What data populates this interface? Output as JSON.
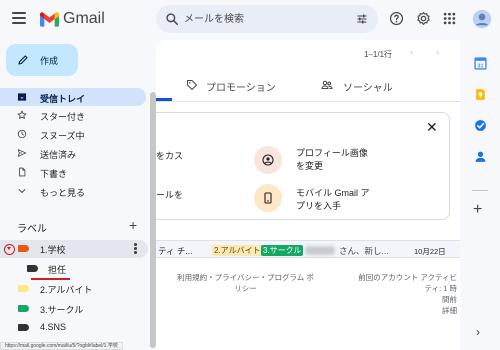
{
  "app": {
    "name": "Gmail"
  },
  "search": {
    "placeholder": "メールを検索"
  },
  "compose": {
    "label": "作成"
  },
  "nav": {
    "items": [
      {
        "label": "受信トレイ",
        "icon": "inbox-icon",
        "active": true
      },
      {
        "label": "スター付き",
        "icon": "star-icon"
      },
      {
        "label": "スヌーズ中",
        "icon": "clock-icon"
      },
      {
        "label": "送信済み",
        "icon": "send-icon"
      },
      {
        "label": "下書き",
        "icon": "draft-icon"
      },
      {
        "label": "もっと見る",
        "icon": "chevron-down-icon"
      }
    ]
  },
  "labels": {
    "heading": "ラベル",
    "add": "+",
    "items": [
      {
        "label": "1.学校",
        "color": "#e8590c"
      },
      {
        "label": "担任",
        "color": "#333333"
      },
      {
        "label": "2.アルバイト",
        "color": "#fbe983"
      },
      {
        "label": "3.サークル",
        "color": "#16a765"
      },
      {
        "label": "4.SNS",
        "color": "#333333"
      }
    ]
  },
  "status_url": "https://mail.google.com/mail/u/5/?ogbl#label/1.学校",
  "main": {
    "pagination": "1–1/1行",
    "tabs": [
      {
        "label": "プロモーション",
        "icon": "tag-icon"
      },
      {
        "label": "ソーシャル",
        "icon": "people-icon"
      }
    ],
    "promo": {
      "close": "✕",
      "left1": "をカス",
      "left2": "ールを",
      "profile": "プロフィール画像\nを変更",
      "mobile": "モバイル Gmail ア\nプリを入手"
    },
    "mail": {
      "sender": "ティ チ...",
      "chips": [
        {
          "label": "2.アルバイト",
          "bg": "#fce8b2",
          "fg": "#594c05"
        },
        {
          "label": "3.サークル",
          "bg": "#16a765",
          "fg": "#ffffff"
        }
      ],
      "snippet": "さん、新し...",
      "date": "10月22日"
    },
    "footer": {
      "links": "利用規約・プライバシー・プログラム ポ\nリシー",
      "activity": "前回のアカウント アクティビティ: 1 時\n間前\n詳細"
    }
  },
  "colors": {
    "accent_blue": "#0b57d0",
    "compose_bg": "#c2e7ff",
    "active_nav": "#d3e3fd",
    "annotation_red": "#c5221f"
  }
}
